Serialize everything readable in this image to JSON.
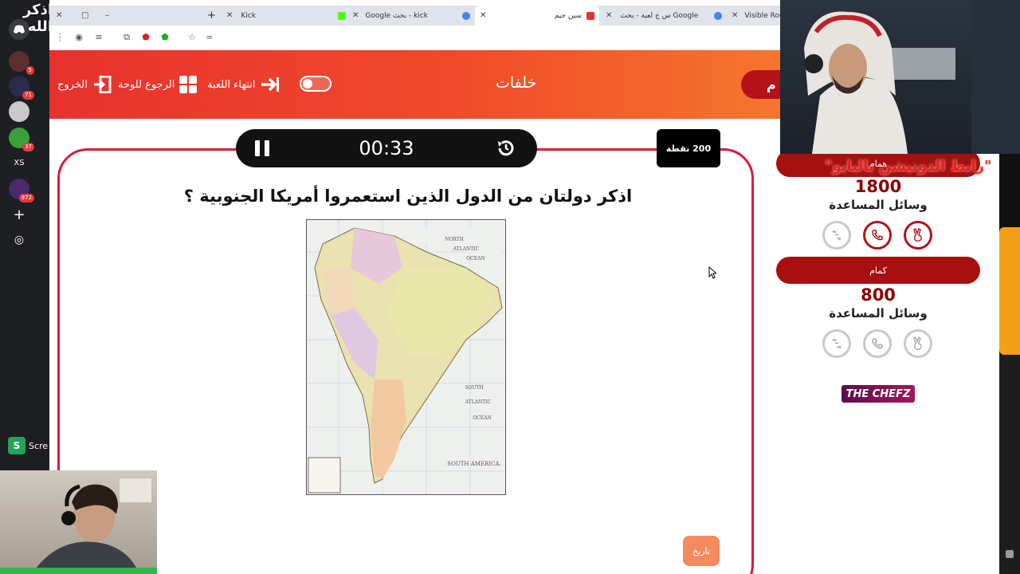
{
  "overlay": {
    "top_left_text": "اذكر الله",
    "marquee_text": "\"رابط الدونيشن بالبايو\"",
    "screen_share_label": "Scre"
  },
  "sidebar": {
    "servers": [
      {
        "label": "",
        "badge": ""
      },
      {
        "label": "",
        "badge": "5"
      },
      {
        "label": "",
        "badge": "71"
      },
      {
        "label": "",
        "badge": ""
      },
      {
        "label": "",
        "badge": "37"
      },
      {
        "label": "XS",
        "badge": ""
      },
      {
        "label": "",
        "badge": "972"
      }
    ]
  },
  "browser": {
    "tabs": [
      {
        "title": "Visible Room",
        "icon": "visible-room-icon"
      },
      {
        "title": "س ج لعبة - بحث Google",
        "icon": "google-icon"
      },
      {
        "title": "سين جيم",
        "icon": "seen-jeem-icon",
        "active": true
      },
      {
        "title": "kick - بحث Google",
        "icon": "google-icon"
      },
      {
        "title": "Kick",
        "icon": "kick-icon"
      }
    ],
    "new_tab_symbol": "+"
  },
  "header": {
    "title": "خلفات",
    "team_pill": "م",
    "exit_label": "الخروج",
    "back_label": "الرجوع للوحة",
    "end_game_label": "انتهاء اللعبة"
  },
  "question": {
    "timer": "00:33",
    "points": "200 نقطة",
    "text": "اذكر دولتان من الدول الذين استعمروا أمريكا الجنوبية ؟",
    "category": "تاريخ",
    "map_labels": {
      "north_atlantic": "NORTH ATLANTIC OCEAN",
      "south_atlantic": "SOUTH ATLANTIC OCEAN",
      "title": "SOUTH AMERICA."
    }
  },
  "teams": [
    {
      "name": "همام",
      "score": "1800",
      "aids_title": "وسائل المساعدة",
      "aids_active": true
    },
    {
      "name": "كمام",
      "score": "800",
      "aids_title": "وسائل المساعدة",
      "aids_active": false
    }
  ],
  "sponsor": "THE CHEFZ",
  "colors": {
    "header_start": "#e8322e",
    "header_end": "#f5762e",
    "accent": "#b3121b",
    "card_border": "#d61e3a"
  }
}
